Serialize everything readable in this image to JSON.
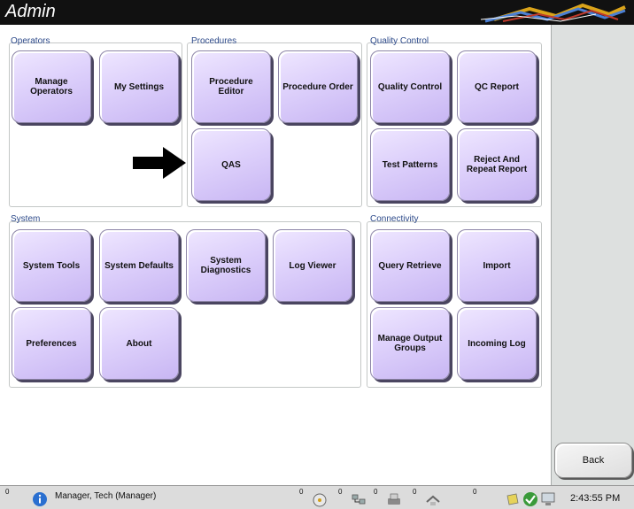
{
  "window": {
    "title": "Admin"
  },
  "groups": {
    "operators": {
      "label": "Operators"
    },
    "procedures": {
      "label": "Procedures"
    },
    "quality_control": {
      "label": "Quality Control"
    },
    "system": {
      "label": "System"
    },
    "connectivity": {
      "label": "Connectivity"
    }
  },
  "buttons": {
    "manage_operators": "Manage Operators",
    "my_settings": "My Settings",
    "procedure_editor": "Procedure Editor",
    "procedure_order": "Procedure Order",
    "qas": "QAS",
    "quality_control": "Quality Control",
    "qc_report": "QC Report",
    "test_patterns": "Test Patterns",
    "reject_and_repeat_report": "Reject And Repeat Report",
    "system_tools": "System Tools",
    "system_defaults": "System Defaults",
    "system_diagnostics": "System Diagnostics",
    "log_viewer": "Log Viewer",
    "preferences": "Preferences",
    "about": "About",
    "query_retrieve": "Query Retrieve",
    "import": "Import",
    "manage_output_groups": "Manage Output Groups",
    "incoming_log": "Incoming Log",
    "back": "Back"
  },
  "status_bar": {
    "alert_count": "0",
    "user": "Manager, Tech (Manager)",
    "queue_counts": [
      "0",
      "0",
      "0",
      "0",
      "0"
    ],
    "time": "2:43:55 PM"
  },
  "icons": [
    "info-icon",
    "disc-icon",
    "network-icon",
    "printer-icon",
    "transfer-icon",
    "storage-icon",
    "check-icon",
    "computer-icon",
    "arrow-right-icon",
    "logo-icon"
  ],
  "colors": {
    "tile_accent": "#ddd0fb",
    "title_bar": "#111111",
    "section_label": "#2d4a8a"
  }
}
